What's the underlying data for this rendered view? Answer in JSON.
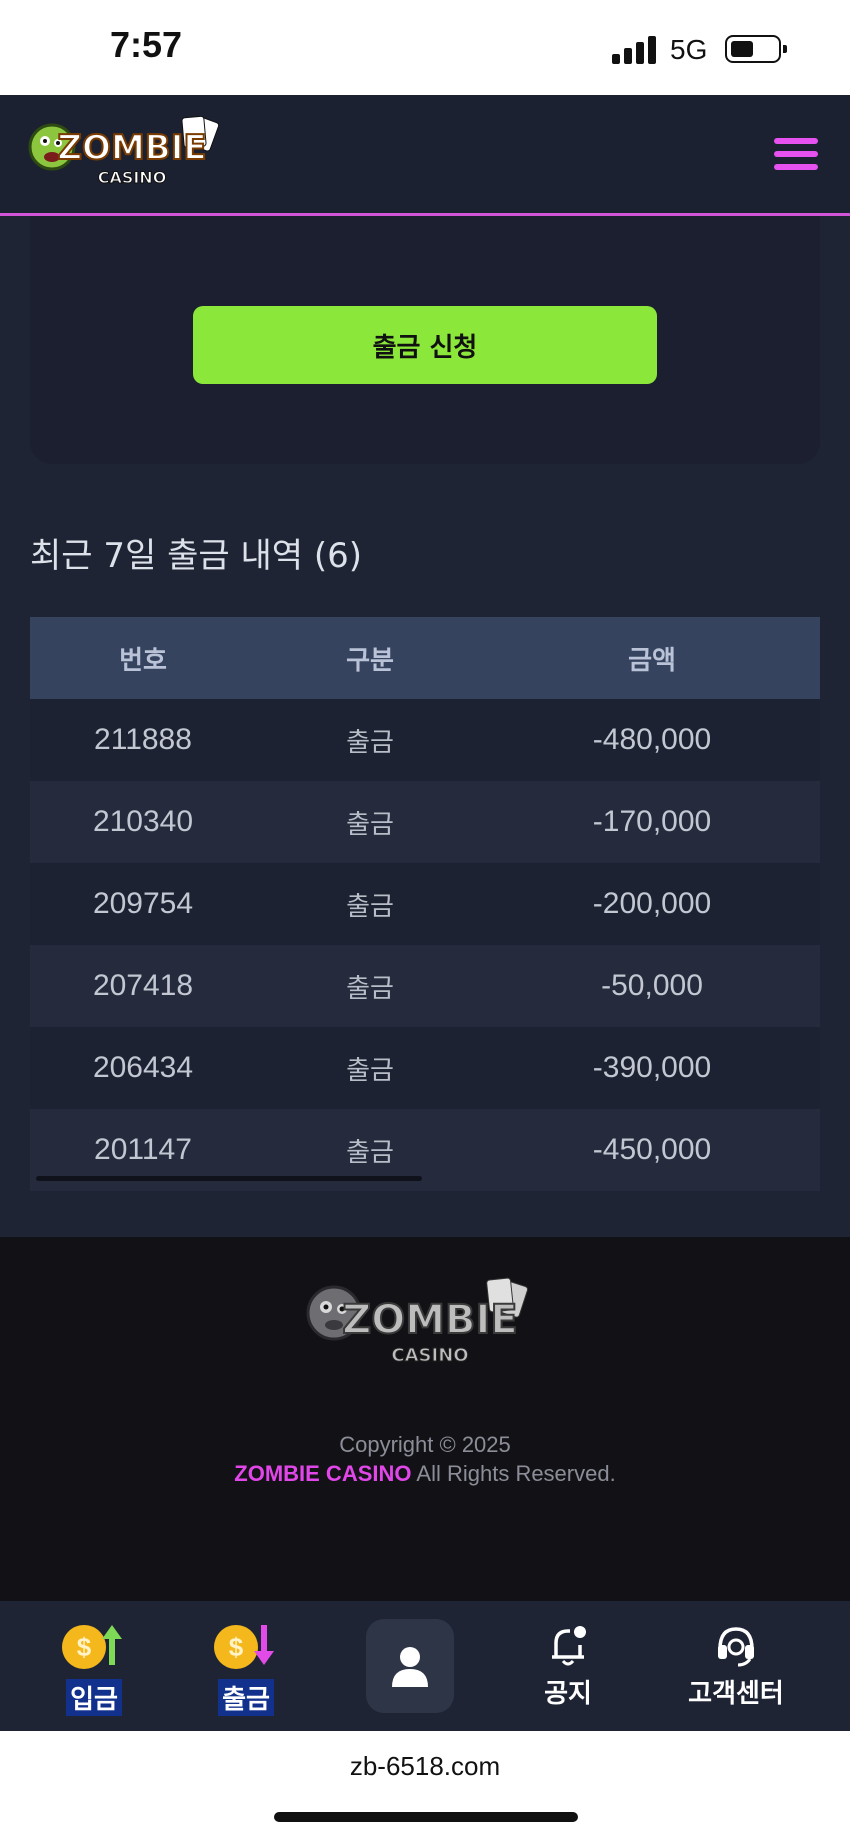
{
  "status_bar": {
    "time": "7:57",
    "network": "5G"
  },
  "header": {
    "logo_text": "ZOMBIE",
    "logo_subtext": "CASINO"
  },
  "form": {
    "withdraw_button": "출금 신청"
  },
  "history": {
    "title": "최근 7일 출금 내역 (6)",
    "columns": [
      "번호",
      "구분",
      "금액"
    ],
    "rows": [
      {
        "id": "211888",
        "type": "출금",
        "amount": "-480,000"
      },
      {
        "id": "210340",
        "type": "출금",
        "amount": "-170,000"
      },
      {
        "id": "209754",
        "type": "출금",
        "amount": "-200,000"
      },
      {
        "id": "207418",
        "type": "출금",
        "amount": "-50,000"
      },
      {
        "id": "206434",
        "type": "출금",
        "amount": "-390,000"
      },
      {
        "id": "201147",
        "type": "출금",
        "amount": "-450,000"
      }
    ]
  },
  "footer": {
    "logo_text": "ZOMBIE",
    "logo_subtext": "CASINO",
    "copyright": "Copyright © 2025",
    "brand": "ZOMBIE CASINO",
    "rights": "All Rights Reserved."
  },
  "bottom_nav": {
    "deposit": "입금",
    "withdraw": "출금",
    "notice": "공지",
    "support": "고객센터",
    "coin_symbol": "$"
  },
  "browser": {
    "url": "zb-6518.com"
  },
  "colors": {
    "accent": "#e651f0",
    "button": "#8be83a",
    "table_header": "#35435f"
  }
}
